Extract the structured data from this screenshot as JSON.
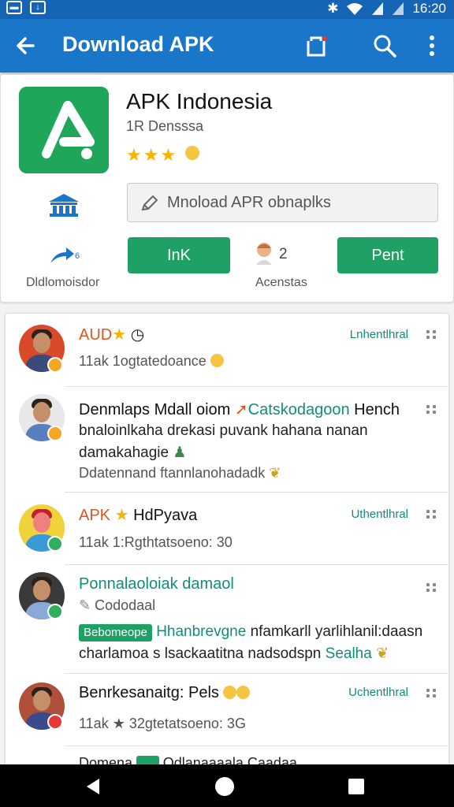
{
  "status_bar": {
    "time": "16:20",
    "left_icons": [
      "sim-icon",
      "download-icon"
    ],
    "right_icons": [
      "bluetooth-icon",
      "wifi-icon",
      "signal-icon",
      "signal-icon"
    ]
  },
  "app_bar": {
    "title": "Download APK",
    "color": "#1976c8",
    "actions": [
      "share-icon",
      "search-icon",
      "more-vert-icon"
    ]
  },
  "app": {
    "name": "APK Indonesia",
    "developer": "1R Densssa",
    "stars": "★★★",
    "search_text": "Mnoload APR obnaplks",
    "install_label": "InK",
    "rent_label": "Pent",
    "share_label": "Dldlomoisdor",
    "agent_count": "2",
    "agent_label": "Acenstas",
    "accent": "#1fa065"
  },
  "reviews": [
    {
      "title": "AUD",
      "star": "★",
      "subtitle": "11ak 1ogtatedoance",
      "status": "Lnhentlhral"
    },
    {
      "title": "Denmlaps Mdall oiom",
      "highlight": "Catskodagoon",
      "title_tail": "Hench",
      "body": "bnaloinlkaha drekasi puvank hahana nanan damakahagie",
      "subtitle": "Ddatennand ftannlanohadadk"
    },
    {
      "title": "APK",
      "star": "★",
      "title_tail": "HdPyava",
      "subtitle": "11ak 1:Rgthtatsoeno: 30",
      "status": "Uthentlhral"
    },
    {
      "title": "Ponnalaoloiak damaol",
      "subtitle": "Cododaal",
      "tag": "Bebomeope",
      "body_green": "Hhanbrevgne",
      "body": "nfamkarll yarlihlanil:daasn charlamoa s lsackaatitna nadsodspn",
      "body_tail": "Sealha"
    },
    {
      "title": "Benrkesanaitg: Pels",
      "subtitle": "11ak ★ 32gtetatsoeno: 3G",
      "status": "Uchentlhral"
    },
    {
      "title": "Domena",
      "tag": "....",
      "title_tail": "Odlanaaaala Caadaa"
    }
  ]
}
